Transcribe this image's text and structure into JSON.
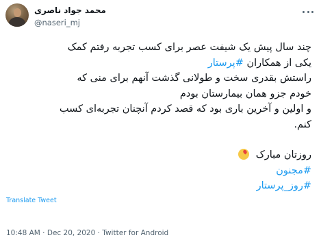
{
  "author": {
    "display_name": "محمد جواد ناصری",
    "handle": "@naseri_mj"
  },
  "tweet": {
    "lines": [
      [
        {
          "t": "چند سال پیش یک شیفت عصر برای کسب تجربه رفتم کمک"
        }
      ],
      [
        {
          "t": "یکی از همکاران "
        },
        {
          "t": "#پرستار",
          "tag": true
        }
      ],
      [
        {
          "t": "راستش بقدری سخت و طولانی گذشت آنهم برای منی که"
        }
      ],
      [
        {
          "t": "خودم جزو همان بیمارستان بودم"
        }
      ],
      [
        {
          "t": "و اولین و آخرین باری بود که قصد کردم آنچنان تجربه‌ای کسب"
        }
      ],
      [
        {
          "t": "کنم."
        }
      ]
    ],
    "greeting": "روزتان مبارک",
    "greeting_emoji": "kissing-heart-emoji",
    "hashtags": [
      "#مجنون",
      "#روز_پرستار"
    ]
  },
  "translate_label": "Translate Tweet",
  "meta": {
    "time": "10:48 AM",
    "separator1": " · ",
    "date": "Dec 20, 2020",
    "separator2": " · ",
    "source": "Twitter for Android"
  },
  "colors": {
    "link": "#1d9bf0",
    "text": "#0f1419",
    "secondary": "#536471"
  }
}
